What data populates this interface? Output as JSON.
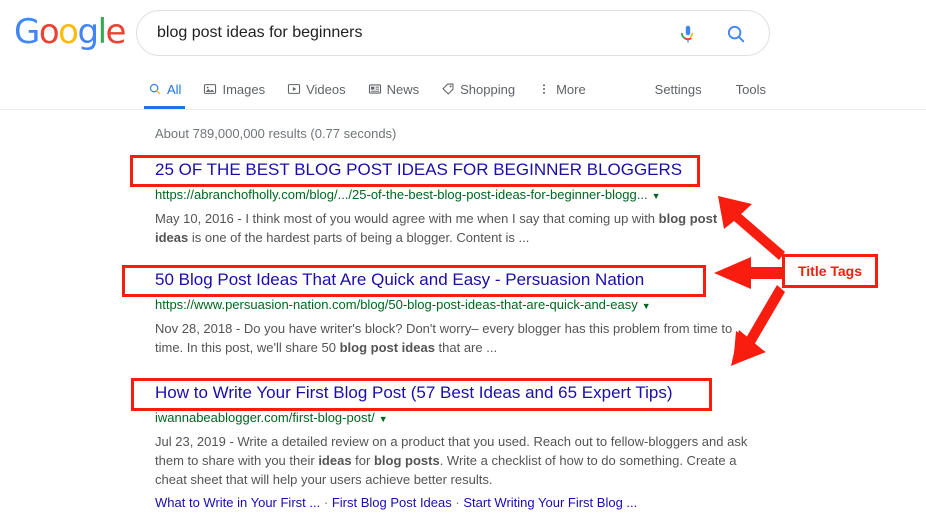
{
  "brand": {
    "logo_letters": [
      {
        "ch": "G",
        "color": "#4285F4"
      },
      {
        "ch": "o",
        "color": "#EA4335"
      },
      {
        "ch": "o",
        "color": "#FBBC05"
      },
      {
        "ch": "g",
        "color": "#4285F4"
      },
      {
        "ch": "l",
        "color": "#34A853"
      },
      {
        "ch": "e",
        "color": "#EA4335"
      }
    ],
    "name": "Google"
  },
  "search": {
    "query": "blog post ideas for beginners",
    "placeholder": "Search",
    "mic_icon": "microphone-icon",
    "search_icon": "search-icon"
  },
  "nav": {
    "tabs": [
      {
        "label": "All",
        "icon": "search-icon",
        "active": true
      },
      {
        "label": "Images",
        "icon": "image-icon",
        "active": false
      },
      {
        "label": "Videos",
        "icon": "video-icon",
        "active": false
      },
      {
        "label": "News",
        "icon": "news-icon",
        "active": false
      },
      {
        "label": "Shopping",
        "icon": "tag-icon",
        "active": false
      },
      {
        "label": "More",
        "icon": "more-vertical-icon",
        "active": false
      }
    ],
    "right_tabs": [
      {
        "label": "Settings"
      },
      {
        "label": "Tools"
      }
    ]
  },
  "results_meta": {
    "stats": "About 789,000,000 results (0.77 seconds)"
  },
  "results": [
    {
      "title": "25 OF THE BEST BLOG POST IDEAS FOR BEGINNER BLOGGERS",
      "url": "https://abranchofholly.com/blog/.../25-of-the-best-blog-post-ideas-for-beginner-blogg...",
      "date": "May 10, 2016",
      "snippet_pre": " - I think most of you would agree with me when I say that coming up with ",
      "snippet_bold": "blog post ideas",
      "snippet_post": " is one of the hardest parts of being a blogger. Content is ..."
    },
    {
      "title": "50 Blog Post Ideas That Are Quick and Easy - Persuasion Nation",
      "url": "https://www.persuasion-nation.com/blog/50-blog-post-ideas-that-are-quick-and-easy",
      "date": "Nov 28, 2018",
      "snippet_pre": " - Do you have writer's block? Don't worry– every blogger has this problem from time to time. In this post, we'll share 50 ",
      "snippet_bold": "blog post ideas",
      "snippet_post": " that are ..."
    },
    {
      "title": "How to Write Your First Blog Post (57 Best Ideas and 65 Expert Tips)",
      "url": "iwannabeablogger.com/first-blog-post/",
      "date": "Jul 23, 2019",
      "snippet_pre": " - Write a detailed review on a product that you used. Reach out to fellow-bloggers and ask them to share with you their ",
      "snippet_bold": "ideas",
      "snippet_mid": " for ",
      "snippet_bold2": "blog posts",
      "snippet_post": ". Write a checklist of how to do something. Create a cheat sheet that will help your users achieve better results.",
      "sitelinks": [
        "What to Write in Your First ...",
        "First Blog Post Ideas",
        "Start Writing Your First Blog ..."
      ],
      "sitelink_separator": "·"
    }
  ],
  "annotation": {
    "label": "Title Tags",
    "color": "#f81d0e",
    "highlight_count": 3,
    "arrow_count": 3
  }
}
